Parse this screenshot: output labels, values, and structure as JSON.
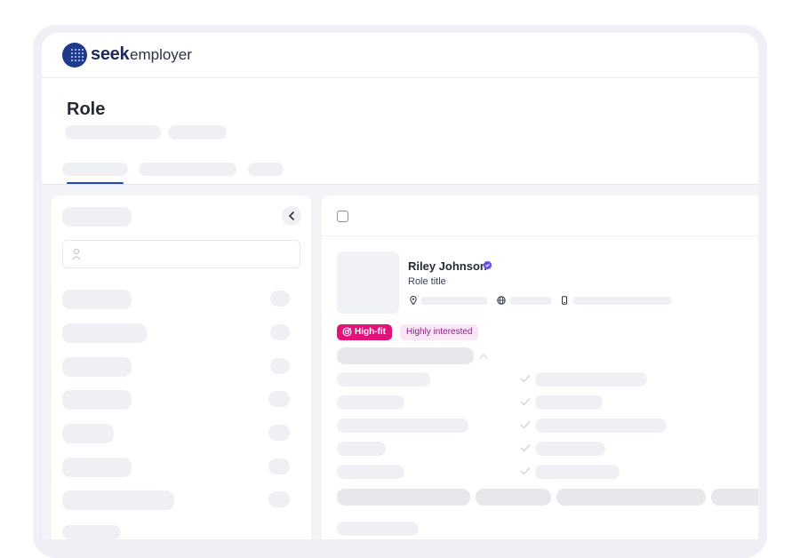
{
  "brand": {
    "seek": "seek",
    "employer": "employer",
    "accent": "#2146c0"
  },
  "page": {
    "title": "Role"
  },
  "candidate": {
    "name": "Riley Johnson",
    "role": "Role title",
    "badges": {
      "fit": "High-fit",
      "interest": "Highly interested"
    },
    "colors": {
      "fit_bg": "#e0137a",
      "interest_bg": "#f9e6f6",
      "interest_text": "#8a1e83",
      "verified": "#6b4fe0"
    }
  },
  "icons": {
    "logo": "seek-logo-icon",
    "collapse": "chevron-left-icon",
    "search": "person-search-icon",
    "verified": "verified-badge-icon",
    "location": "location-pin-icon",
    "web": "globe-icon",
    "device": "phone-icon",
    "fit": "target-icon",
    "expand": "chevron-up-icon",
    "check": "check-icon"
  }
}
